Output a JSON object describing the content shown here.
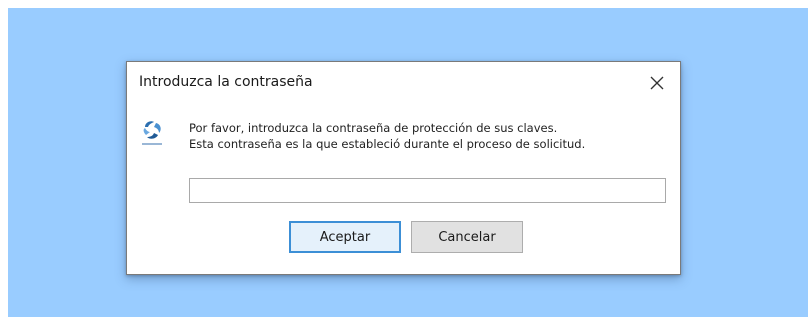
{
  "dialog": {
    "title": "Introduzca la contraseña",
    "close_icon": "close-icon",
    "app_icon": "app-logo-icon",
    "message_line_1": "Por favor, introduzca la contraseña de protección de sus claves.",
    "message_line_2": "Esta contraseña es la que estableció durante el proceso de solicitud.",
    "password_value": "",
    "accept_label": "Aceptar",
    "cancel_label": "Cancelar"
  },
  "colors": {
    "backdrop": "#99ccff",
    "accent_border": "#3c8fd6",
    "accept_bg": "#e5f1fb",
    "cancel_bg": "#e1e1e1"
  }
}
